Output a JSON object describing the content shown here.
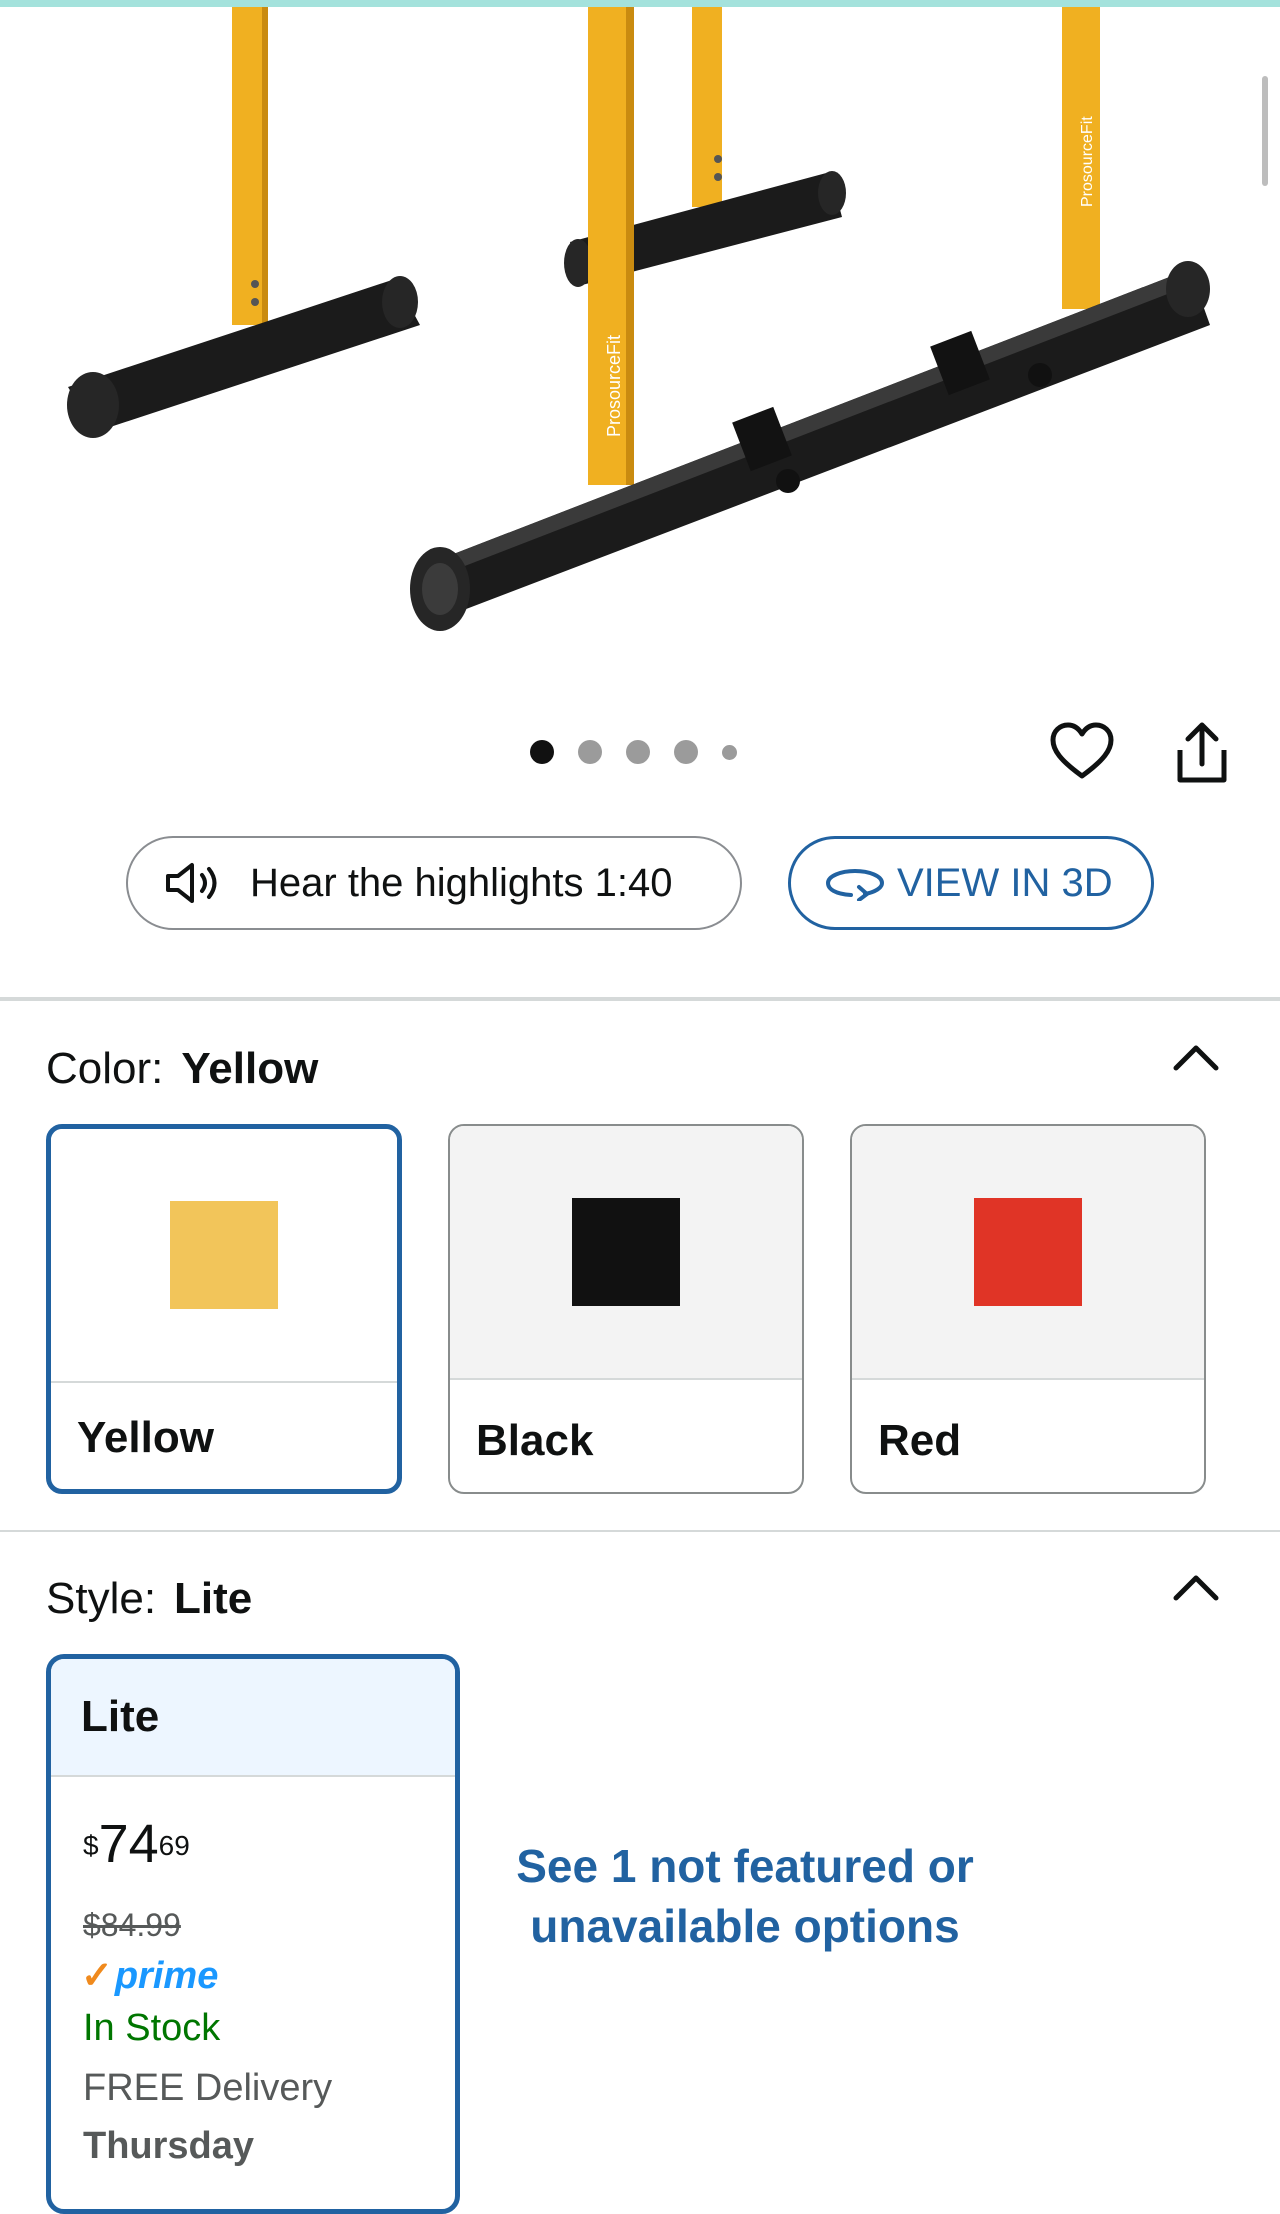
{
  "gallery": {
    "dots": 5,
    "active_dot": 1,
    "brand_text": "ProsourceFit"
  },
  "actions": {
    "favorite_icon": "heart-icon",
    "share_icon": "share-icon"
  },
  "audio_pill": {
    "icon": "speaker-icon",
    "label": "Hear the highlights 1:40"
  },
  "view3d_pill": {
    "icon": "rotate-3d-icon",
    "label": "VIEW IN 3D"
  },
  "color_section": {
    "label": "Color:",
    "selected": "Yellow",
    "options": [
      {
        "name": "Yellow",
        "color": "#F2C55A"
      },
      {
        "name": "Black",
        "color": "#111111"
      },
      {
        "name": "Red",
        "color": "#E03426"
      }
    ]
  },
  "style_section": {
    "label": "Style:",
    "selected": "Lite",
    "card": {
      "title": "Lite",
      "currency": "$",
      "price_whole": "74",
      "price_fraction": "69",
      "list_price": "$84.99",
      "prime_label": "prime",
      "stock": "In Stock",
      "delivery": "FREE Delivery",
      "delivery_day": "Thursday"
    },
    "see_more": "See 1 not featured or unavailable options"
  },
  "colors": {
    "accent_blue": "#2162A1",
    "prime_blue": "#1A98FF",
    "stock_green": "#007600"
  }
}
